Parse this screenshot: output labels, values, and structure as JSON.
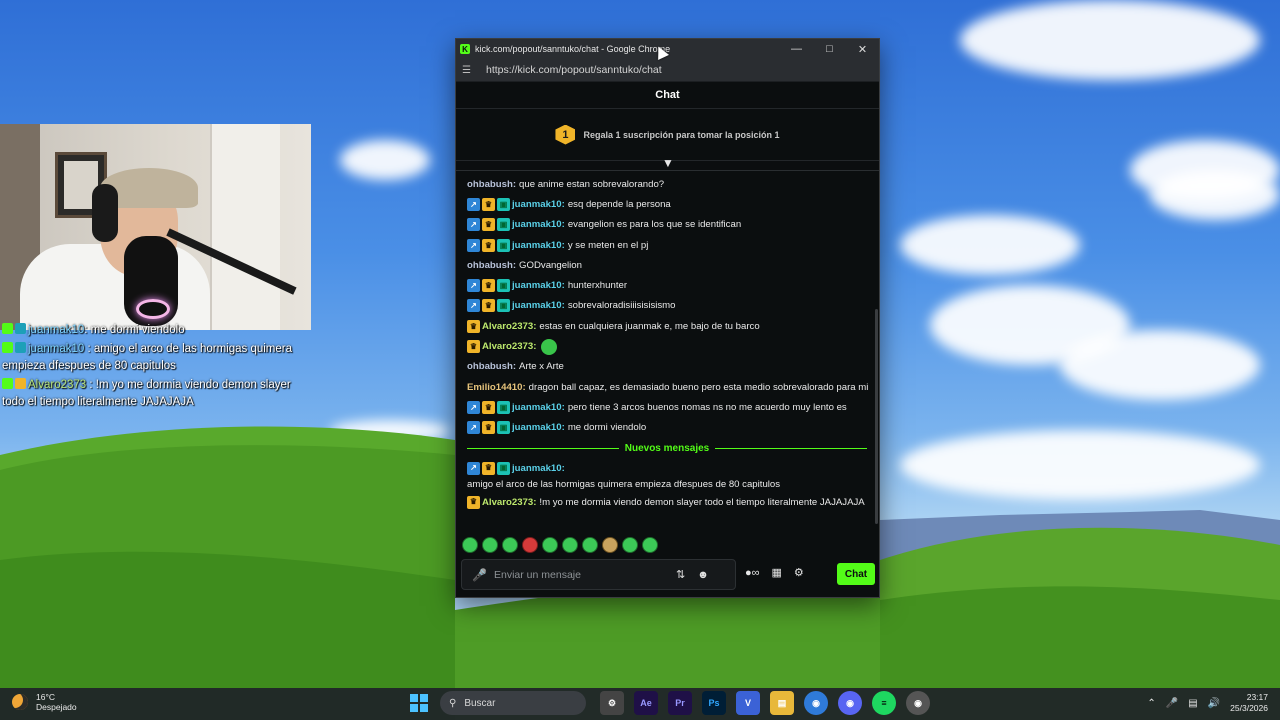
{
  "browser": {
    "title": "kick.com/popout/sanntuko/chat - Google Chrome",
    "url": "https://kick.com/popout/sanntuko/chat",
    "favicon_letter": "K"
  },
  "chat": {
    "header": "Chat",
    "sub_goal": {
      "position": "1",
      "text": "Regala 1 suscripción para tomar la posición 1"
    },
    "messages": [
      {
        "badges": [],
        "user": "ohbabush",
        "color": "gray",
        "text": "que anime estan sobrevalorando?"
      },
      {
        "badges": [
          "arrow",
          "crown",
          "sub"
        ],
        "user": "juanmak10",
        "color": "blue",
        "text": "esq depende la persona"
      },
      {
        "badges": [
          "arrow",
          "crown",
          "sub"
        ],
        "user": "juanmak10",
        "color": "blue",
        "text": "evangelion es para los que se identifican"
      },
      {
        "badges": [
          "arrow",
          "crown",
          "sub"
        ],
        "user": "juanmak10",
        "color": "blue",
        "text": "y se meten en el pj"
      },
      {
        "badges": [],
        "user": "ohbabush",
        "color": "gray",
        "text": "GODvangelion"
      },
      {
        "badges": [
          "arrow",
          "crown",
          "sub"
        ],
        "user": "juanmak10",
        "color": "blue",
        "text": "hunterxhunter"
      },
      {
        "badges": [
          "arrow",
          "crown",
          "sub"
        ],
        "user": "juanmak10",
        "color": "blue",
        "text": "sobrevaloradisiiisisisismo"
      },
      {
        "badges": [
          "crown"
        ],
        "user": "Alvaro2373",
        "color": "lime",
        "text": "estas en cualquiera juanmak e, me bajo de tu barco"
      },
      {
        "badges": [
          "crown"
        ],
        "user": "Alvaro2373",
        "color": "lime",
        "text": "",
        "emote": true
      },
      {
        "badges": [],
        "user": "ohbabush",
        "color": "gray",
        "text": "Arte x Arte"
      },
      {
        "badges": [],
        "user": "Emilio14410",
        "color": "tan",
        "text": "dragon ball capaz, es demasiado bueno pero esta medio sobrevalorado para mi"
      },
      {
        "badges": [
          "arrow",
          "crown",
          "sub"
        ],
        "user": "juanmak10",
        "color": "blue",
        "text": "pero tiene 3 arcos buenos nomas ns no me acuerdo muy lento es"
      },
      {
        "badges": [
          "arrow",
          "crown",
          "sub"
        ],
        "user": "juanmak10",
        "color": "blue",
        "text": "me dormi viendolo"
      }
    ],
    "new_messages_label": "Nuevos mensajes",
    "new_messages": [
      {
        "badges": [
          "arrow",
          "crown",
          "sub"
        ],
        "user": "juanmak10",
        "color": "blue",
        "text": "amigo el arco de las hormigas quimera empieza dfespues de 80 capitulos"
      },
      {
        "badges": [
          "crown"
        ],
        "user": "Alvaro2373",
        "color": "lime",
        "text": "!m yo me dormia viendo demon slayer todo el tiempo literalmente JAJAJAJA"
      }
    ],
    "input_placeholder": "Enviar un mensaje",
    "send_label": "Chat",
    "accent": "#53fc18"
  },
  "overlay": {
    "lines": [
      {
        "user": "juanmak10",
        "text": ": me dormi viendolo"
      },
      {
        "user": "juanmak10",
        "text": ": amigo el arco de las hormigas quimera empieza dfespues de 80 capitulos"
      },
      {
        "user": "Alvaro2373",
        "text": ": !m yo me dormia viendo demon slayer todo el tiempo literalmente JAJAJAJA"
      }
    ]
  },
  "taskbar": {
    "weather_temp": "16°C",
    "weather_desc": "Despejado",
    "search_label": "Buscar",
    "time": "23:17",
    "date": "25/3/2026"
  }
}
